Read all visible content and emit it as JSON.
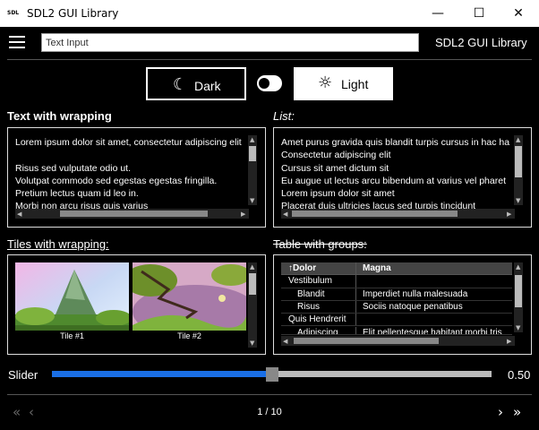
{
  "window": {
    "title": "SDL2 GUI Library",
    "app_icon": "SDL",
    "minimize": "—",
    "maximize": "☐",
    "close": "✕"
  },
  "header": {
    "text_input_value": "Text Input",
    "app_title": "SDL2 GUI Library"
  },
  "theme": {
    "dark_label": "Dark",
    "light_label": "Light",
    "dark_icon": "☾",
    "light_icon": "☼",
    "toggle_on": false
  },
  "text_wrap": {
    "heading": "Text with wrapping",
    "lines": [
      "Lorem ipsum dolor sit amet, consectetur adipiscing elit",
      "",
      "Risus sed vulputate odio ut.",
      "Volutpat commodo sed egestas egestas fringilla.",
      "Pretium lectus quam id leo in.",
      "Morbi non arcu risus quis varius"
    ]
  },
  "list": {
    "heading": "List:",
    "items": [
      "Amet purus gravida quis blandit turpis cursus in hac ha",
      "Consectetur adipiscing elit",
      "Cursus sit amet dictum sit",
      "Eu augue ut lectus arcu bibendum at varius vel pharet",
      "Lorem ipsum dolor sit amet",
      "Placerat duis ultricies lacus sed turpis tincidunt"
    ]
  },
  "tiles": {
    "heading": "Tiles with wrapping:",
    "items": [
      {
        "label": "Tile #1"
      },
      {
        "label": "Tile #2"
      }
    ]
  },
  "table": {
    "heading": "Table with groups:",
    "columns": [
      "↑Dolor",
      "Magna"
    ],
    "rows": [
      {
        "c1": "Vestibulum",
        "c2": "",
        "group": true
      },
      {
        "c1": "Blandit",
        "c2": "Imperdiet nulla malesuada",
        "group": false
      },
      {
        "c1": "Risus",
        "c2": "Sociis natoque penatibus",
        "group": false
      },
      {
        "c1": "Quis Hendrerit",
        "c2": "",
        "group": true
      },
      {
        "c1": "Adipiscing",
        "c2": "Elit pellentesque habitant morbi tris",
        "group": false
      }
    ]
  },
  "slider": {
    "label": "Slider",
    "value": 0.5,
    "value_text": "0.50",
    "fill_color": "#1a6fe6"
  },
  "pager": {
    "first": "«",
    "prev": "‹",
    "next": "›",
    "last": "»",
    "text": "1 / 10"
  }
}
